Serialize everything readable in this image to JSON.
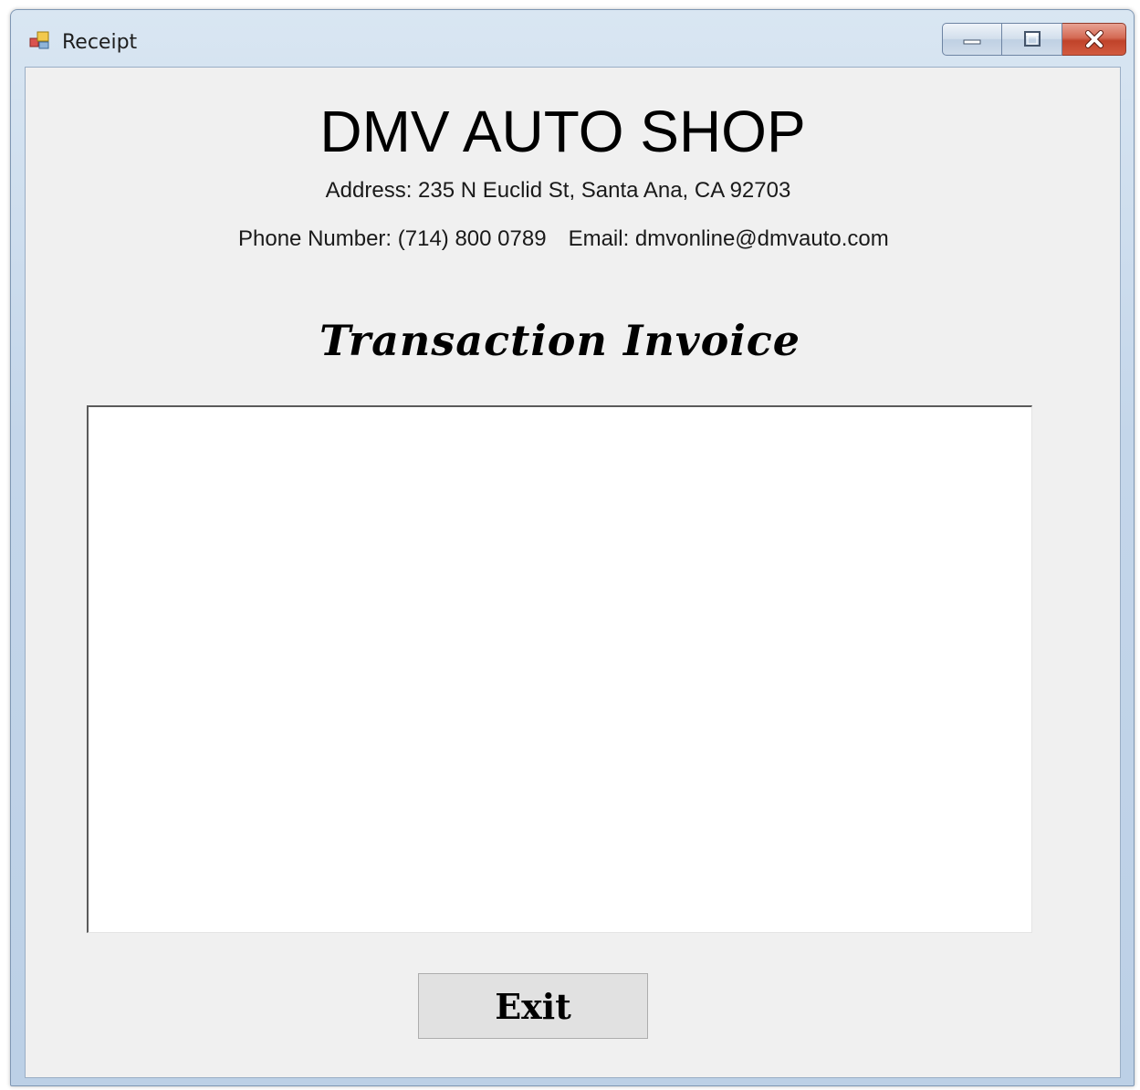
{
  "window": {
    "title": "Receipt",
    "icon": "app-form-icon",
    "buttons": {
      "minimize": "minimize-icon",
      "maximize": "maximize-icon",
      "close": "close-icon"
    },
    "colors": {
      "frame": "#c4d6ea",
      "client_background": "#f0f0f0",
      "close_button": "#c0432a"
    }
  },
  "header": {
    "shop_name": "DMV AUTO SHOP",
    "address": "Address: 235 N Euclid St, Santa Ana, CA 92703",
    "phone": "Phone Number: (714) 800 0789",
    "email": "Email: dmvonline@dmvauto.com"
  },
  "invoice": {
    "heading": "Transaction Invoice",
    "content": ""
  },
  "actions": {
    "exit_label": "Exit"
  }
}
